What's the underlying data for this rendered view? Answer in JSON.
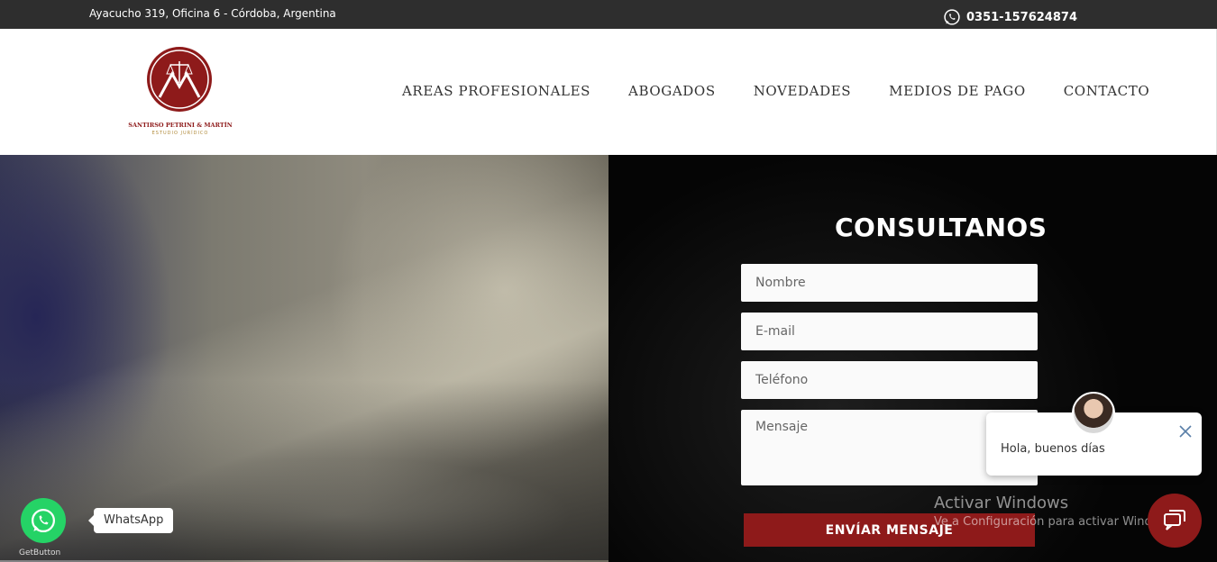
{
  "topbar": {
    "address": "Ayacucho 319, Oficina 6 - Córdoba, Argentina",
    "phone": "0351-157624874",
    "phone_icon": "whatsapp-icon"
  },
  "logo": {
    "brand": "SANTIRSO PETRINI & MARTÍN",
    "subtitle": "ESTUDIO JURÍDICO",
    "color": "#8e1a1a"
  },
  "nav": {
    "items": [
      {
        "label": "AREAS PROFESIONALES"
      },
      {
        "label": "ABOGADOS"
      },
      {
        "label": "NOVEDADES"
      },
      {
        "label": "MEDIOS DE PAGO"
      },
      {
        "label": "CONTACTO"
      }
    ]
  },
  "form": {
    "title": "CONSULTANOS",
    "name_placeholder": "Nombre",
    "email_placeholder": "E-mail",
    "phone_placeholder": "Teléfono",
    "message_placeholder": "Mensaje",
    "submit_label": "ENVÍAR MENSAJE"
  },
  "whatsapp_widget": {
    "label": "WhatsApp",
    "provider": "GetButton",
    "icon": "whatsapp-icon",
    "color": "#25d366"
  },
  "chat_widget": {
    "message": "Hola, buenos días",
    "close_icon": "close-icon",
    "launcher_icon": "chat-icon"
  },
  "windows_watermark": {
    "title": "Activar Windows",
    "subtitle": "Ve a Configuración para activar Windows."
  }
}
